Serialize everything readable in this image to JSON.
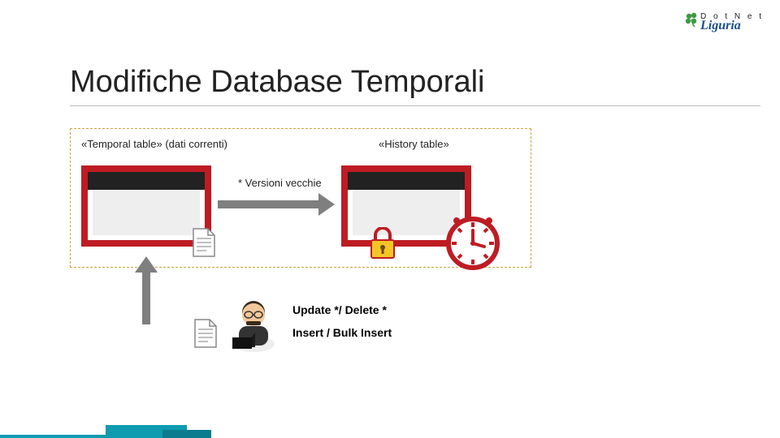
{
  "logo": {
    "line1": "D o t N e t",
    "line2": "Liguria"
  },
  "title": "Modifiche Database Temporali",
  "labels": {
    "temporal": "«Temporal table» (dati correnti)",
    "history": "«History table»",
    "versions": "* Versioni vecchie"
  },
  "ops": {
    "update_delete": "Update */ Delete *",
    "insert": "Insert / Bulk Insert"
  },
  "colors": {
    "accent_red": "#be1c23",
    "accent_gold": "#c7a63b",
    "accent_teal": "#0f9bb0",
    "lock_yellow": "#f4c527",
    "arrow_gray": "#7f7f7f"
  }
}
